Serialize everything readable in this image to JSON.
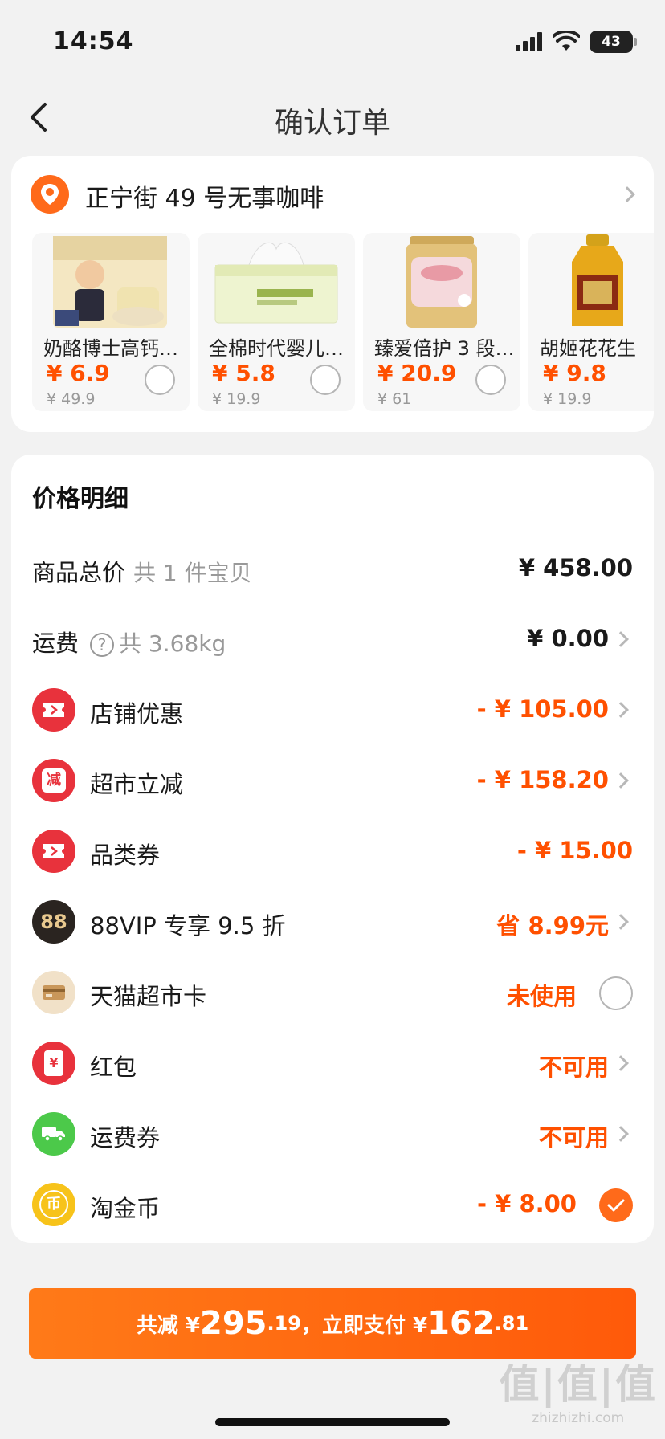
{
  "status": {
    "time": "14:54",
    "battery": "43"
  },
  "nav": {
    "title": "确认订单"
  },
  "address": {
    "text": "正宁街 49 号无事咖啡"
  },
  "products": [
    {
      "name": "奶酪博士高钙…",
      "price": "¥ 6.9",
      "original": "¥ 49.9"
    },
    {
      "name": "全棉时代婴儿…",
      "price": "¥ 5.8",
      "original": "¥ 19.9"
    },
    {
      "name": "臻爱倍护 3 段…",
      "price": "¥ 20.9",
      "original": "¥ 61"
    },
    {
      "name": "胡姬花花生",
      "price": "¥ 9.8",
      "original": "¥ 19.9"
    }
  ],
  "price_detail": {
    "title": "价格明细",
    "subtotal": {
      "label": "商品总价",
      "sub": "共 1 件宝贝",
      "value": "¥ 458.00"
    },
    "shipping": {
      "label": "运费",
      "help": "?",
      "sub": "共 3.68kg",
      "value": "¥ 0.00"
    },
    "rows": [
      {
        "label": "店铺优惠",
        "value": "- ¥ 105.00",
        "icon": "ticket-icon"
      },
      {
        "label": "超市立减",
        "value": "- ¥ 158.20",
        "icon": "reduce-icon",
        "icon_text": "减"
      },
      {
        "label": "品类券",
        "value": "- ¥ 15.00",
        "icon": "coupon-icon"
      },
      {
        "label": "88VIP 专享 9.5 折",
        "value": "省 8.99元",
        "icon": "vip88-icon",
        "icon_text": "88"
      },
      {
        "label": "天猫超市卡",
        "value": "未使用",
        "icon": "card-icon"
      },
      {
        "label": "红包",
        "value": "不可用",
        "icon": "red-packet-icon",
        "icon_text": "¥"
      },
      {
        "label": "运费券",
        "value": "不可用",
        "icon": "truck-icon"
      },
      {
        "label": "淘金币",
        "value": "- ¥ 8.00",
        "icon": "coin-icon",
        "icon_text": "币"
      }
    ]
  },
  "pay": {
    "prefix": "共减 ¥",
    "reduce_int": "295",
    "reduce_dec": ".19",
    "middle": "，立即支付 ¥",
    "pay_int": "162",
    "pay_dec": ".81"
  },
  "watermark": {
    "big": "值|值|值",
    "small": "zhizhizhi.com"
  },
  "colors": {
    "accent": "#ff5000",
    "button": "#ff6a1a"
  }
}
